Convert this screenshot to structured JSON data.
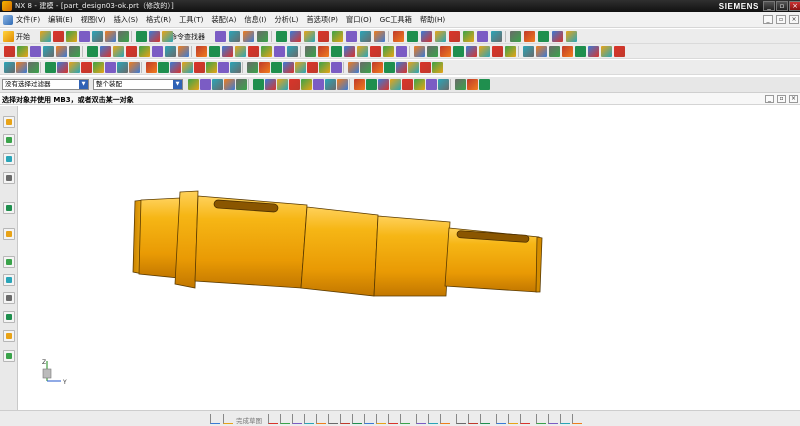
{
  "titlebar": {
    "title": "NX 8 - 建模 - [part_design03-ok.prt（修改的）]",
    "brand": "SIEMENS",
    "min": "_",
    "restore": "▫",
    "close": "×"
  },
  "menubar": {
    "items": [
      "文件(F)",
      "编辑(E)",
      "视图(V)",
      "插入(S)",
      "格式(R)",
      "工具(T)",
      "装配(A)",
      "信息(I)",
      "分析(L)",
      "首选项(P)",
      "窗口(O)",
      "GC工具箱",
      "帮助(H)"
    ],
    "win_min": "_",
    "win_restore": "▫",
    "win_close": "×"
  },
  "toolbar1": {
    "start_label": "开始",
    "command_finder_label": "命令查找器"
  },
  "selection_bar": {
    "type_filter": "没有选择过滤器",
    "scope": "整个装配"
  },
  "cue_line": {
    "text": "选择对象并使用 MB3，或者双击某一对象"
  },
  "snap_toolbar": {
    "label": "完成草图"
  },
  "triad": {
    "x": "X",
    "y": "Y",
    "z": "Z"
  },
  "colors": {
    "part_body": "#f0ac08",
    "part_dark": "#7a4a00",
    "title_bg": "#1e1e1e",
    "selection_combo_arrow": "#2f62b5"
  },
  "icons": {
    "titlebar": "nx-app-icon",
    "menubar": "nx-menu-icon"
  }
}
